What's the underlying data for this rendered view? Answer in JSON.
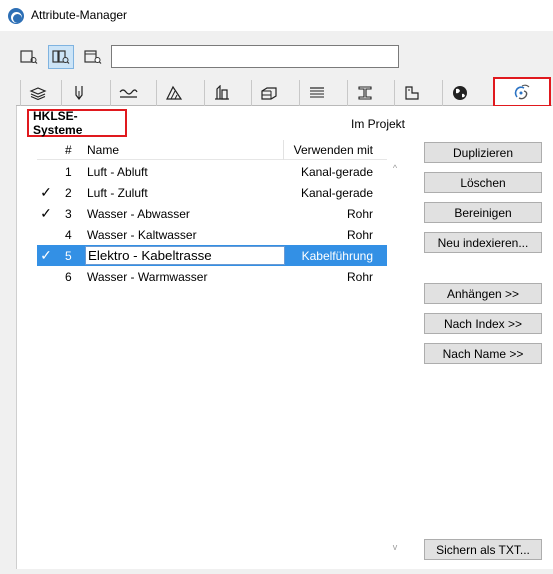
{
  "window": {
    "title": "Attribute-Manager"
  },
  "view_buttons": [
    {
      "name": "view-mode-1-button",
      "active": false
    },
    {
      "name": "view-mode-2-button",
      "active": true
    },
    {
      "name": "view-mode-3-button",
      "active": false
    }
  ],
  "search": {
    "value": "",
    "placeholder": ""
  },
  "tabs": [
    {
      "name": "tab-layers",
      "icon": "layers-icon"
    },
    {
      "name": "tab-pens",
      "icon": "pen-icon"
    },
    {
      "name": "tab-line-types",
      "icon": "line-type-icon"
    },
    {
      "name": "tab-fill-types",
      "icon": "fill-type-icon"
    },
    {
      "name": "tab-composites",
      "icon": "composite-icon"
    },
    {
      "name": "tab-materials",
      "icon": "material-icon"
    },
    {
      "name": "tab-surfaces",
      "icon": "surface-icon"
    },
    {
      "name": "tab-profiles",
      "icon": "profile-icon"
    },
    {
      "name": "tab-zone-categories",
      "icon": "zone-category-icon"
    },
    {
      "name": "tab-locations",
      "icon": "globe-icon"
    },
    {
      "name": "tab-mep-systems",
      "icon": "mep-systems-icon",
      "selected": true
    }
  ],
  "section": {
    "title": "HKLSE-Systeme",
    "project_label": "Im Projekt"
  },
  "table": {
    "headers": {
      "number": "#",
      "name": "Name",
      "use": "Verwenden mit"
    },
    "rows": [
      {
        "checked": false,
        "number": "1",
        "name": "Luft - Abluft",
        "use": "Kanal-gerade",
        "selected": false
      },
      {
        "checked": true,
        "number": "2",
        "name": "Luft - Zuluft",
        "use": "Kanal-gerade",
        "selected": false
      },
      {
        "checked": true,
        "number": "3",
        "name": "Wasser - Abwasser",
        "use": "Rohr",
        "selected": false
      },
      {
        "checked": false,
        "number": "4",
        "name": "Wasser - Kaltwasser",
        "use": "Rohr",
        "selected": false
      },
      {
        "checked": true,
        "number": "5",
        "name": "Elektro - Kabeltrasse",
        "use": "Kabelführung",
        "selected": true
      },
      {
        "checked": false,
        "number": "6",
        "name": "Wasser - Warmwasser",
        "use": "Rohr",
        "selected": false
      }
    ],
    "check_mark": "✓",
    "scroll_up": "^",
    "scroll_down": "v"
  },
  "buttons": {
    "duplicate": "Duplizieren",
    "delete": "Löschen",
    "purge": "Bereinigen",
    "reindex": "Neu indexieren...",
    "append": "Anhängen >>",
    "by_index": "Nach Index >>",
    "by_name": "Nach Name >>",
    "save_txt": "Sichern als TXT..."
  },
  "colors": {
    "selection": "#3390e5",
    "highlight_box": "#e0191e",
    "active_view": "#cce4f7"
  }
}
